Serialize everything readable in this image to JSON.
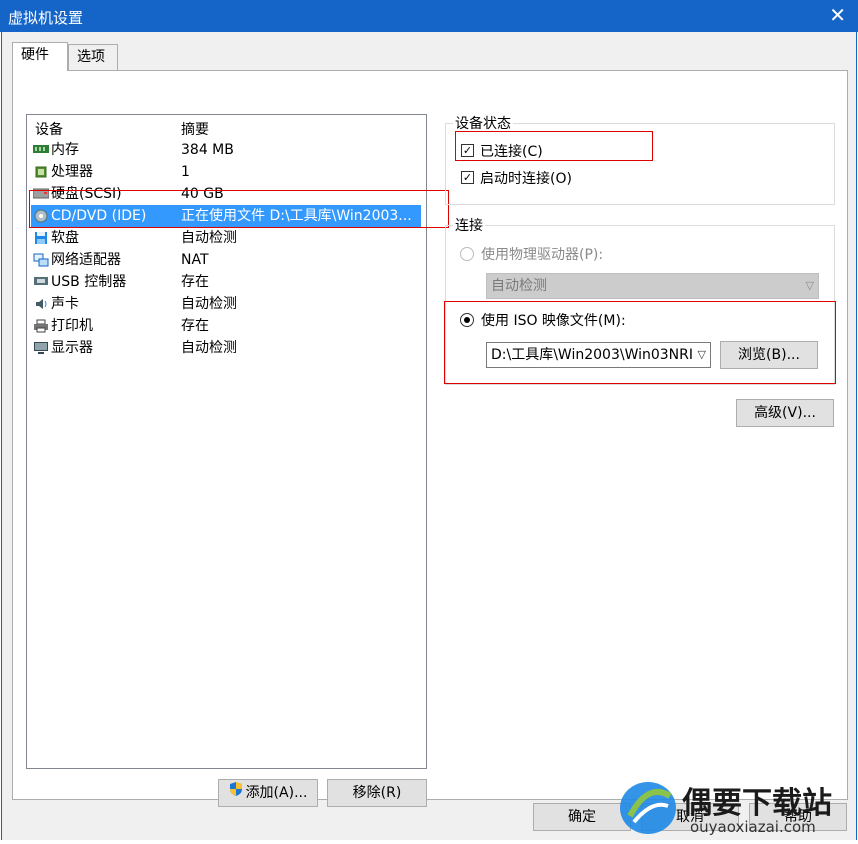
{
  "window": {
    "title": "虚拟机设置",
    "close_glyph": "✕"
  },
  "tabs": [
    {
      "label": "硬件"
    },
    {
      "label": "选项"
    }
  ],
  "device_list": {
    "headers": {
      "device": "设备",
      "summary": "摘要"
    },
    "items": [
      {
        "icon": "memory-icon",
        "name": "内存",
        "summary": "384 MB"
      },
      {
        "icon": "processor-icon",
        "name": "处理器",
        "summary": "1"
      },
      {
        "icon": "hard-disk-icon",
        "name": "硬盘(SCSI)",
        "summary": "40 GB"
      },
      {
        "icon": "cd-dvd-icon",
        "name": "CD/DVD (IDE)",
        "summary": "正在使用文件 D:\\工具库\\Win2003...",
        "selected": true
      },
      {
        "icon": "floppy-icon",
        "name": "软盘",
        "summary": "自动检测"
      },
      {
        "icon": "network-adapter-icon",
        "name": "网络适配器",
        "summary": "NAT"
      },
      {
        "icon": "usb-icon",
        "name": "USB 控制器",
        "summary": "存在"
      },
      {
        "icon": "sound-card-icon",
        "name": "声卡",
        "summary": "自动检测"
      },
      {
        "icon": "printer-icon",
        "name": "打印机",
        "summary": "存在"
      },
      {
        "icon": "display-icon",
        "name": "显示器",
        "summary": "自动检测"
      }
    ]
  },
  "list_buttons": {
    "add": "添加(A)...",
    "remove": "移除(R)"
  },
  "device_status": {
    "label": "设备状态",
    "connected": {
      "label": "已连接(C)",
      "checked": true
    },
    "connect_at_power_on": {
      "label": "启动时连接(O)",
      "checked": true
    }
  },
  "connection": {
    "label": "连接",
    "physical_drive": {
      "label": "使用物理驱动器(P):",
      "enabled": false,
      "value": "自动检测"
    },
    "iso_image": {
      "label": "使用 ISO 映像文件(M):",
      "selected": true,
      "value": "D:\\工具库\\Win2003\\Win03NRI"
    },
    "browse_label": "浏览(B)..."
  },
  "advanced_label": "高级(V)...",
  "dialog_buttons": {
    "ok": "确定",
    "cancel": "取消",
    "help": "帮助"
  },
  "watermark": {
    "brand": "偶要下载站",
    "url": "ouyaoxiazai.com"
  },
  "colors": {
    "titlebar": "#1565c8",
    "selection": "#3399ff",
    "highlight_box": "#e00000"
  }
}
